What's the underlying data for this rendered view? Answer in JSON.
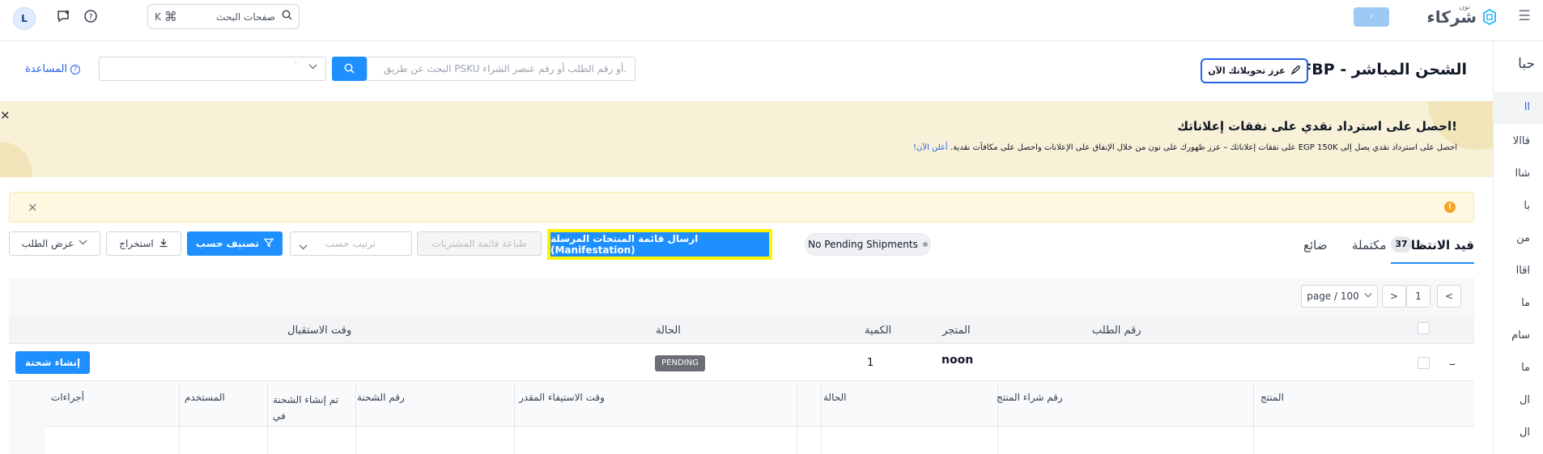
{
  "topbar": {
    "logo_text": "شركاء",
    "logo_sub": "نون",
    "store_pill": "ı",
    "user_initial": "L",
    "search_placeholder": "صفحات البحث",
    "shortcut_cmd": "⌘",
    "shortcut_key": "K"
  },
  "sidebar": {
    "header": "حبا",
    "items": [
      "اا",
      "قاالا",
      "شاا",
      "با",
      "من",
      "اقاا",
      "ما",
      "سام",
      "ما",
      "ال",
      "ال"
    ]
  },
  "header": {
    "title": "FBP - الشحن المباشر",
    "boost_label": "عزز تحويلاتك الآن",
    "order_search_placeholder": "البحث عن طريق PSKU أو رقم الطلب أو رقم عنصر الشراء.",
    "help_label": "المساعدة",
    "filter_dot": "·"
  },
  "promo": {
    "headline": "احصل على استرداد نقدي على نفقات إعلاناتك!",
    "body": "احصل على استرداد نقدي يصل إلى EGP 150K على نفقات إعلاناتك – عزز ظهورك على نون من خلال الإنفاق على الإعلانات واحصل على مكافآت نقدية.",
    "link": "أعلن الآن!",
    "close": "×"
  },
  "warning": {
    "icon": "!",
    "close": "×"
  },
  "tabs": {
    "pending": "قيد الانتظار",
    "completed_count": "37",
    "completed": "مكتملة",
    "lost": "ضائع"
  },
  "toolbar": {
    "pending_pill": "No Pending Shipments",
    "manifest_button": "ارسال قائمة المنتجات المرسلة (Manifestation)",
    "print_button": "طباعة قائمة المشتريات",
    "sort_placeholder": "ترتيب حسب",
    "classify_button": "تصنيف حسب",
    "export_button": "استخراج",
    "view_button": "عرض الطلب"
  },
  "pager": {
    "per_page": "page / 100",
    "current": "1",
    "next": ">",
    "prev": "<"
  },
  "table": {
    "headers": {
      "order_number": "رقم الطلب",
      "store": "المتجر",
      "quantity": "الكمية",
      "status": "الحالة",
      "receive_time": "وقت الاستقبال"
    },
    "row": {
      "store": "noon",
      "quantity": "1",
      "status": "PENDING",
      "create_shipment": "إنشاء شحنة",
      "collapse": "–"
    },
    "sub_headers": {
      "product": "المنتج",
      "product_po": "رقم شراء المنتج",
      "status": "الحالة",
      "fulfill_time": "وقت الاستيفاء المقدر",
      "shipment_no": "رقم الشحنة",
      "shipment_created": "تم إنشاء الشحنة في",
      "user": "المستخدم",
      "actions": "أجراءات"
    }
  },
  "colors": {
    "primary": "#1d8fff",
    "highlight_border": "#fff200",
    "promo_bg": "#f8f1d8",
    "warning_bg": "#fff8e1"
  }
}
